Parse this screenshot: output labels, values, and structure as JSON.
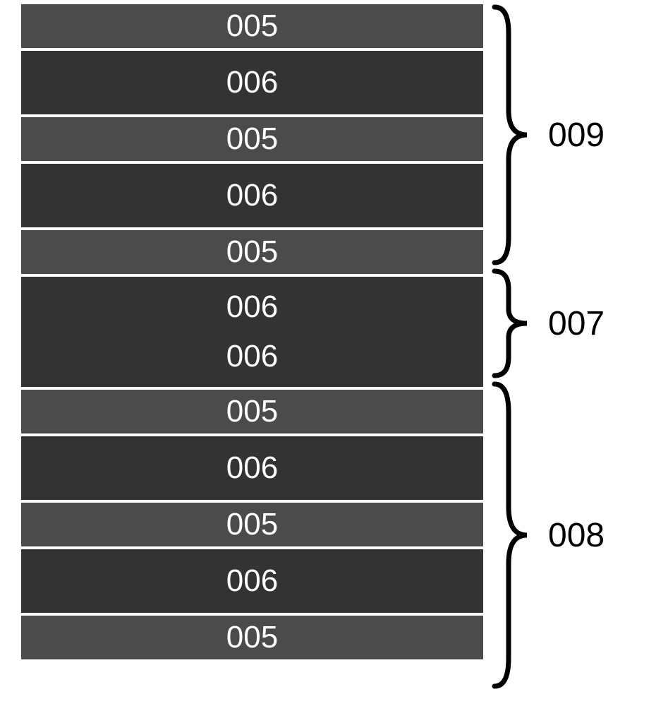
{
  "layers": [
    {
      "label": "005",
      "shade": "light"
    },
    {
      "label": "006",
      "shade": "dark"
    },
    {
      "label": "005",
      "shade": "light"
    },
    {
      "label": "006",
      "shade": "dark"
    },
    {
      "label": "005",
      "shade": "light"
    },
    {
      "label_a": "006",
      "label_b": "006",
      "shade": "dark-double"
    },
    {
      "label": "005",
      "shade": "light"
    },
    {
      "label": "006",
      "shade": "dark"
    },
    {
      "label": "005",
      "shade": "light"
    },
    {
      "label": "006",
      "shade": "dark"
    },
    {
      "label": "005",
      "shade": "light"
    }
  ],
  "groups": {
    "top": {
      "label": "009"
    },
    "middle": {
      "label": "007"
    },
    "bottom": {
      "label": "008"
    }
  }
}
